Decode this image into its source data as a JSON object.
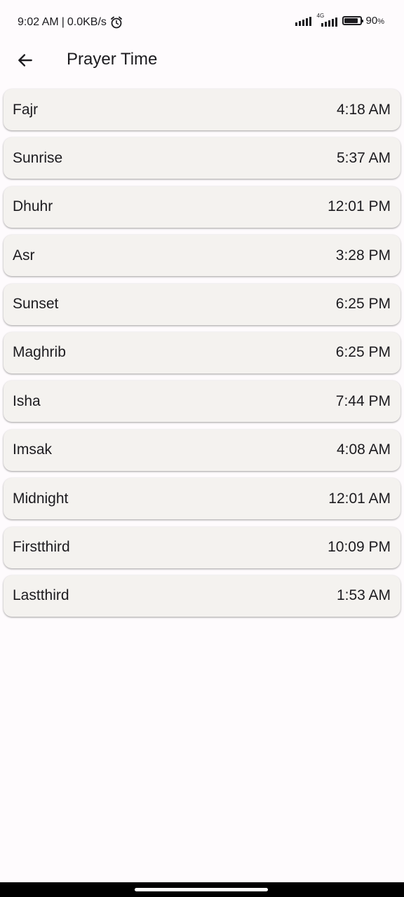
{
  "status_bar": {
    "time": "9:02 AM",
    "separator": "|",
    "speed": "0.0KB/s",
    "network_label": "4G",
    "battery_level": "90",
    "battery_unit": "%",
    "battery_fraction": 0.9,
    "icons": [
      "alarm-icon",
      "signal-icon",
      "signal-4g-icon",
      "battery-icon"
    ]
  },
  "app_bar": {
    "title": "Prayer Time",
    "back_icon": "arrow-left-icon"
  },
  "prayers": [
    {
      "name": "Fajr",
      "time": "4:18 AM"
    },
    {
      "name": "Sunrise",
      "time": "5:37 AM"
    },
    {
      "name": "Dhuhr",
      "time": "12:01 PM"
    },
    {
      "name": "Asr",
      "time": "3:28 PM"
    },
    {
      "name": "Sunset",
      "time": "6:25 PM"
    },
    {
      "name": "Maghrib",
      "time": "6:25 PM"
    },
    {
      "name": "Isha",
      "time": "7:44 PM"
    },
    {
      "name": "Imsak",
      "time": "4:08 AM"
    },
    {
      "name": "Midnight",
      "time": "12:01 AM"
    },
    {
      "name": "Firstthird",
      "time": "10:09 PM"
    },
    {
      "name": "Lastthird",
      "time": "1:53 AM"
    }
  ],
  "colors": {
    "background": "#fefbfd",
    "card": "#f4f2ef",
    "text": "#1c1b1f"
  }
}
